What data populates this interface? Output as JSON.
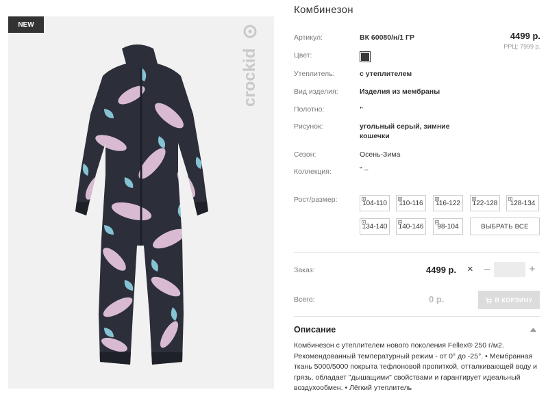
{
  "image": {
    "badge": "NEW",
    "logo_text": "crockid"
  },
  "product": {
    "title": "Комбинезон",
    "price": "4499 р.",
    "rrp": "РРЦ: 7999 р.",
    "attributes": [
      {
        "label": "Артикул:",
        "value": "ВК 60080/н/1 ГР"
      },
      {
        "label": "Цвет:",
        "value": ""
      },
      {
        "label": "Утеплитель:",
        "value": "с утеплителем"
      },
      {
        "label": "Вид изделия:",
        "value": "Изделия из мембраны"
      },
      {
        "label": "Полотно:",
        "value": "\""
      },
      {
        "label": "Рисунок:",
        "value": "угольный серый, зимние кошечки"
      },
      {
        "label": "Сезон:",
        "value": "Осень-Зима"
      },
      {
        "label": "Коллекция:",
        "value": "\" –"
      }
    ],
    "color_swatch": "#3a3a3a",
    "sizes_label": "Рост/размер:",
    "sizes": [
      "104-110",
      "110-116",
      "116-122",
      "122-128",
      "128-134",
      "134-140",
      "140-146",
      "98-104"
    ],
    "select_all": "ВЫБРАТЬ ВСЕ"
  },
  "order": {
    "label": "Заказ:",
    "price": "4499 р.",
    "multiply": "×",
    "minus": "–",
    "plus": "+",
    "qty_value": ""
  },
  "total": {
    "label": "Всего:",
    "value": "0 р.",
    "cart_button": "В КОРЗИНУ"
  },
  "description": {
    "title": "Описание",
    "text": "Комбинезон с утеплителем нового поколения Fellex® 250 г/м2. Рекомендованный температурный режим - от 0° до -25°. • Мембранная ткань 5000/5000 покрыта тефлоновой пропиткой, отталкивающей воду и грязь, обладает \"дышащими\" свойствами и гарантирует идеальный воздухообмен. • Лёгкий утеплитель"
  },
  "colors": {
    "badge_bg": "#333333",
    "garment_base": "#2c2f3a",
    "pattern_pink": "#e8c8e0",
    "pattern_blue": "#8fd4e6",
    "cart_disabled": "#dcdcdc"
  }
}
